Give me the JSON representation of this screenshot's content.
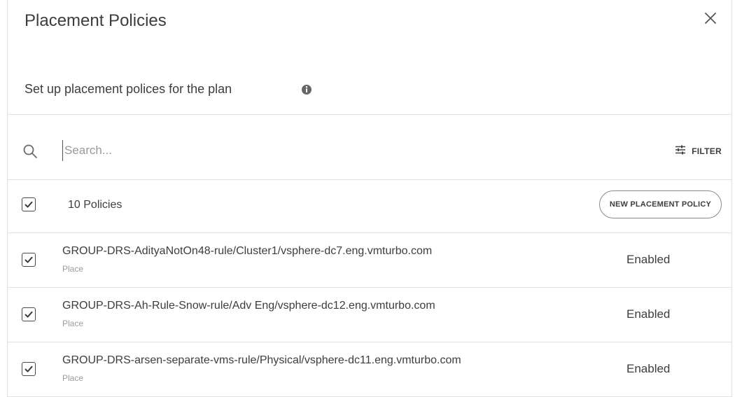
{
  "header": {
    "title": "Placement Policies"
  },
  "subtitle": "Set up placement polices for the plan",
  "search": {
    "placeholder": "Search...",
    "value": ""
  },
  "filter": {
    "label": "FILTER"
  },
  "summary": {
    "count_label": "10 Policies",
    "new_button_label": "NEW PLACEMENT POLICY",
    "all_checked": true
  },
  "policies": [
    {
      "name": "GROUP-DRS-AdityaNotOn48-rule/Cluster1/vsphere-dc7.eng.vmturbo.com",
      "type": "Place",
      "status": "Enabled",
      "checked": true
    },
    {
      "name": "GROUP-DRS-Ah-Rule-Snow-rule/Adv Eng/vsphere-dc12.eng.vmturbo.com",
      "type": "Place",
      "status": "Enabled",
      "checked": true
    },
    {
      "name": "GROUP-DRS-arsen-separate-vms-rule/Physical/vsphere-dc11.eng.vmturbo.com",
      "type": "Place",
      "status": "Enabled",
      "checked": true
    }
  ],
  "icons": {
    "close": "close-icon",
    "info": "info-icon",
    "search": "search-icon",
    "filter": "sliders-icon",
    "check": "checkmark-icon"
  },
  "colors": {
    "text": "#3d3d3d",
    "muted": "#9c9c9c",
    "divider": "#e1e1e1"
  }
}
